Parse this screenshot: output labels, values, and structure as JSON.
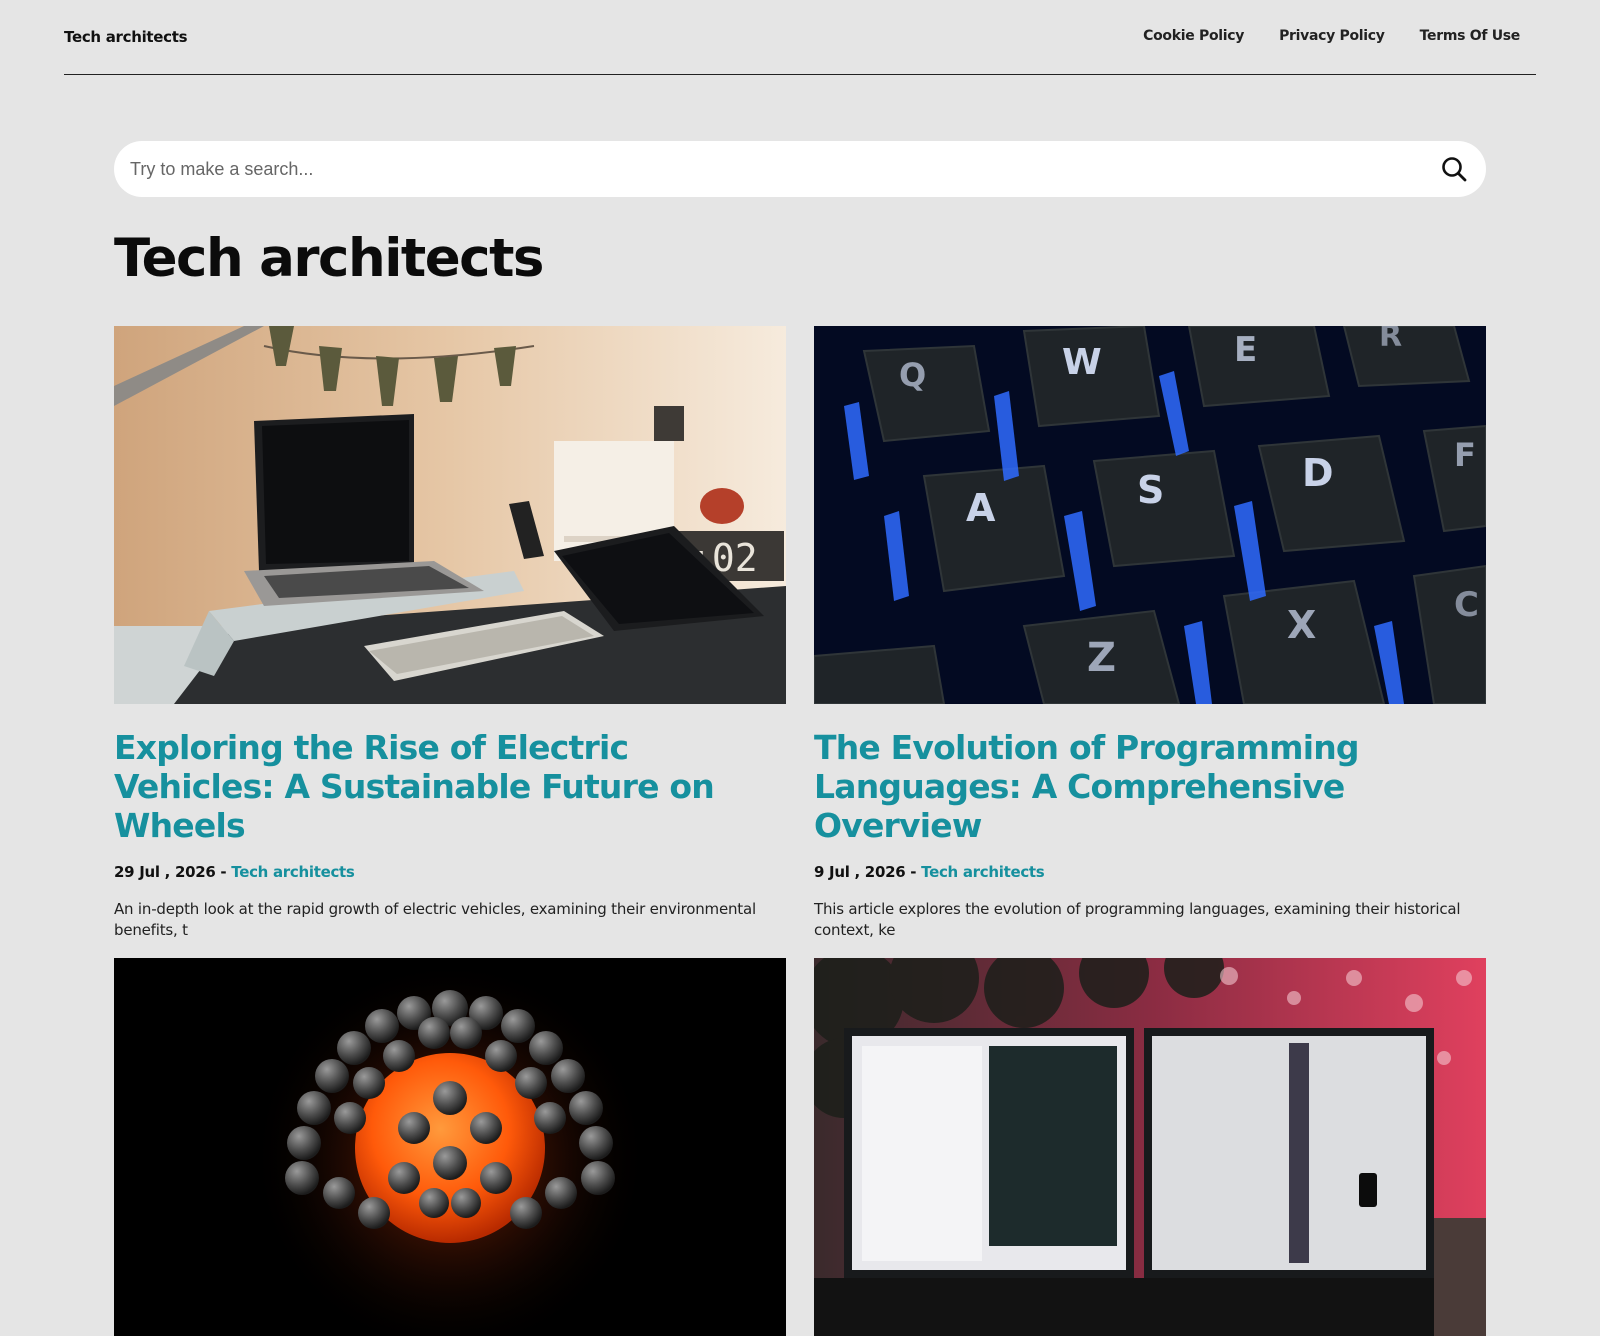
{
  "header": {
    "site_name": "Tech architects",
    "nav": [
      "Cookie Policy",
      "Privacy Policy",
      "Terms Of Use"
    ]
  },
  "search": {
    "placeholder": "Try to make a search..."
  },
  "page_title": "Tech architects",
  "articles": [
    {
      "title": "Exploring the Rise of Electric Vehicles: A Sustainable Future on Wheels",
      "date": "29 Jul , 2026",
      "separator": " - ",
      "category": "Tech architects",
      "excerpt": "An in-depth look at the rapid growth of electric vehicles, examining their environmental benefits, t",
      "image": "desk-workspace-photo"
    },
    {
      "title": "The Evolution of Programming Languages: A Comprehensive Overview",
      "date": "9 Jul , 2026",
      "separator": " - ",
      "category": "Tech architects",
      "excerpt": "This article explores the evolution of programming languages, examining their historical context, ke",
      "image": "keyboard-keys-photo"
    },
    {
      "image": "molecule-render-image"
    },
    {
      "image": "dual-monitor-code-photo"
    }
  ],
  "colors": {
    "accent": "#16909e",
    "background": "#e5e5e5"
  }
}
